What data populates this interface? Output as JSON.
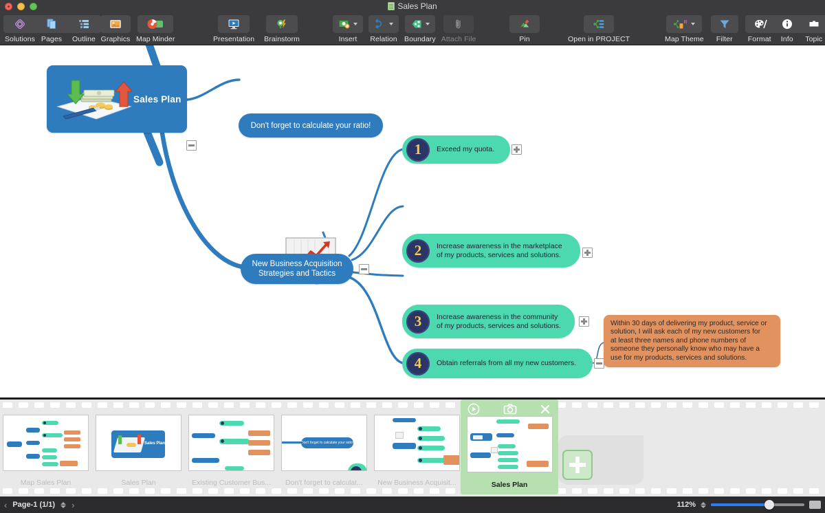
{
  "window": {
    "title": "Sales Plan",
    "doc_icon": "document-icon",
    "controls": [
      "close",
      "minimize",
      "maximize"
    ]
  },
  "toolbar": {
    "groups": [
      {
        "name": "left",
        "items": [
          {
            "label": "Solutions",
            "icon": "solutions-icon",
            "segmented": true,
            "disabled": false,
            "dropdown": false
          },
          {
            "label": "Pages",
            "icon": "pages-icon",
            "segmented": true,
            "disabled": false,
            "dropdown": false
          },
          {
            "label": "Outline",
            "icon": "outline-icon",
            "segmented": true,
            "disabled": false,
            "dropdown": false
          }
        ]
      },
      {
        "name": "graphics",
        "items": [
          {
            "label": "Graphics",
            "icon": "graphics-icon",
            "segmented": false,
            "disabled": false,
            "dropdown": false
          },
          {
            "label": "Map Minder",
            "icon": "map-minder-icon",
            "segmented": false,
            "disabled": false,
            "dropdown": false
          }
        ]
      },
      {
        "name": "present",
        "items": [
          {
            "label": "Presentation",
            "icon": "presentation-icon",
            "segmented": false,
            "disabled": false,
            "dropdown": false
          },
          {
            "label": "Brainstorm",
            "icon": "brainstorm-icon",
            "segmented": false,
            "disabled": false,
            "dropdown": false
          }
        ]
      },
      {
        "name": "edit",
        "items": [
          {
            "label": "Insert",
            "icon": "insert-icon",
            "segmented": false,
            "disabled": false,
            "dropdown": true
          },
          {
            "label": "Relation",
            "icon": "relation-icon",
            "segmented": false,
            "disabled": false,
            "dropdown": true
          },
          {
            "label": "Boundary",
            "icon": "boundary-icon",
            "segmented": false,
            "disabled": false,
            "dropdown": true
          },
          {
            "label": "Attach File",
            "icon": "attach-file-icon",
            "segmented": false,
            "disabled": true,
            "dropdown": false
          }
        ]
      },
      {
        "name": "pin",
        "items": [
          {
            "label": "Pin",
            "icon": "pin-icon",
            "segmented": false,
            "disabled": false,
            "dropdown": false
          }
        ]
      },
      {
        "name": "project",
        "items": [
          {
            "label": "Open in PROJECT",
            "icon": "open-in-project-icon",
            "segmented": false,
            "disabled": false,
            "dropdown": false
          }
        ]
      },
      {
        "name": "right",
        "items": [
          {
            "label": "Map Theme",
            "icon": "map-theme-icon",
            "segmented": false,
            "disabled": false,
            "dropdown": true
          },
          {
            "label": "Filter",
            "icon": "filter-icon",
            "segmented": false,
            "disabled": false,
            "dropdown": false
          },
          {
            "label": "Format",
            "icon": "format-icon",
            "segmented": true,
            "disabled": false,
            "dropdown": false
          },
          {
            "label": "Info",
            "icon": "info-icon",
            "segmented": true,
            "disabled": false,
            "dropdown": false
          },
          {
            "label": "Topic",
            "icon": "topic-icon",
            "segmented": true,
            "disabled": false,
            "dropdown": false
          }
        ]
      }
    ]
  },
  "map": {
    "central": {
      "label": "Sales Plan",
      "image": "sales-plan-money-image",
      "collapse": "minus"
    },
    "callout": {
      "label": "Don't forget to calculate your ratio!"
    },
    "branch": {
      "label": "New Business Acquisition\nStrategies and Tactics",
      "line1": "New Business Acquisition",
      "line2": "Strategies and Tactics",
      "image": "growth-chart-coins-image",
      "collapse": "minus"
    },
    "topics": [
      {
        "number": "1",
        "line1": "Exceed my quota.",
        "line2": "",
        "toggle": "plus"
      },
      {
        "number": "2",
        "line1": "Increase awareness in the marketplace",
        "line2": "of my products, services and solutions.",
        "toggle": "plus"
      },
      {
        "number": "3",
        "line1": "Increase awareness in the community",
        "line2": "of my products, services and solutions.",
        "toggle": "plus"
      },
      {
        "number": "4",
        "line1": "Obtain referrals from all my new customers.",
        "line2": "",
        "toggle": "minus"
      }
    ],
    "note": {
      "lines": [
        "Within 30 days of delivering my product, service or",
        "solution, I will ask each of my new customers for",
        "at least three names and phone numbers of",
        "someone they personally know who may have a",
        "use for my products, services and solutions."
      ]
    },
    "colors": {
      "central": "#2e7cbe",
      "topic": "#4dd9b0",
      "number_circle": "#2b3566",
      "number_text": "#f5d04e",
      "note": "#e2925f",
      "connector": "#2e7cbe"
    }
  },
  "filmstrip": {
    "thumbnails": [
      {
        "caption": "Map Sales Plan",
        "selected": false
      },
      {
        "caption": "Sales Plan",
        "selected": false
      },
      {
        "caption": "Existing Customer Bus...",
        "selected": false
      },
      {
        "caption": "Don't forget to calculat...",
        "selected": false
      },
      {
        "caption": "New Business Acquisit...",
        "selected": false
      },
      {
        "caption": "Sales Plan",
        "selected": true
      }
    ],
    "selected_tools": [
      {
        "name": "play-icon"
      },
      {
        "name": "camera-icon"
      },
      {
        "name": "close-icon"
      }
    ],
    "add_button": "add-page-button"
  },
  "status": {
    "prev": "‹",
    "next": "›",
    "page_label": "Page-1 (1/1)",
    "zoom_label": "112%",
    "fit_button": "fit-to-window-button"
  }
}
